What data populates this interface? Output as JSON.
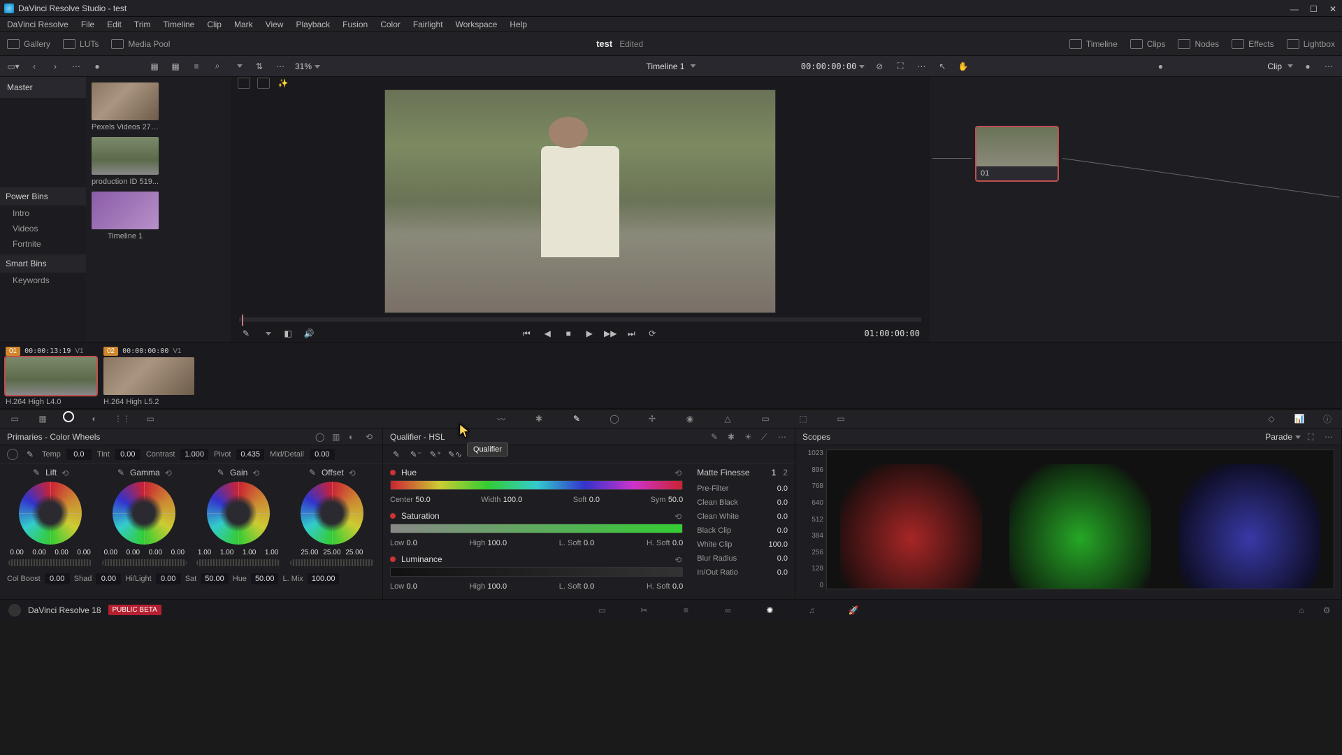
{
  "title": "DaVinci Resolve Studio - test",
  "menu": [
    "DaVinci Resolve",
    "File",
    "Edit",
    "Trim",
    "Timeline",
    "Clip",
    "Mark",
    "View",
    "Playback",
    "Fusion",
    "Color",
    "Fairlight",
    "Workspace",
    "Help"
  ],
  "tabs_left": [
    {
      "icon": "gallery",
      "label": "Gallery"
    },
    {
      "icon": "luts",
      "label": "LUTs"
    },
    {
      "icon": "media",
      "label": "Media Pool"
    }
  ],
  "tabs_right": [
    {
      "icon": "timeline",
      "label": "Timeline"
    },
    {
      "icon": "clips",
      "label": "Clips"
    },
    {
      "icon": "nodes",
      "label": "Nodes"
    },
    {
      "icon": "effects",
      "label": "Effects"
    },
    {
      "icon": "lightbox",
      "label": "Lightbox"
    }
  ],
  "project": {
    "name": "test",
    "status": "Edited"
  },
  "toolbar": {
    "zoom": "31%",
    "timeline_name": "Timeline 1",
    "timecode": "00:00:00:00",
    "clip_label": "Clip"
  },
  "mediapool": {
    "master": "Master",
    "sections": {
      "power": "Power Bins",
      "power_items": [
        "Intro",
        "Videos",
        "Fortnite"
      ],
      "smart": "Smart Bins",
      "smart_items": [
        "Keywords"
      ]
    },
    "thumbs": [
      {
        "label": "Pexels Videos 278...",
        "style": "th1"
      },
      {
        "label": "production ID 519...",
        "style": "th2"
      },
      {
        "label": "Timeline 1",
        "style": "th3"
      }
    ]
  },
  "transport": {
    "tc": "01:00:00:00"
  },
  "node": {
    "label": "01"
  },
  "clips": [
    {
      "num": "01",
      "tc": "00:00:13:19",
      "v": "V1",
      "label": "H.264 High L4.0",
      "style": "th2",
      "active": true
    },
    {
      "num": "02",
      "tc": "00:00:00:00",
      "v": "V1",
      "label": "H.264 High L5.2",
      "style": "th1",
      "active": false
    }
  ],
  "primaries": {
    "title": "Primaries - Color Wheels",
    "adj_top": [
      {
        "lbl": "Temp",
        "val": "0.0"
      },
      {
        "lbl": "Tint",
        "val": "0.00"
      },
      {
        "lbl": "Contrast",
        "val": "1.000"
      },
      {
        "lbl": "Pivot",
        "val": "0.435"
      },
      {
        "lbl": "Mid/Detail",
        "val": "0.00"
      }
    ],
    "wheels": [
      {
        "name": "Lift",
        "vals": [
          "0.00",
          "0.00",
          "0.00",
          "0.00"
        ]
      },
      {
        "name": "Gamma",
        "vals": [
          "0.00",
          "0.00",
          "0.00",
          "0.00"
        ]
      },
      {
        "name": "Gain",
        "vals": [
          "1.00",
          "1.00",
          "1.00",
          "1.00"
        ]
      },
      {
        "name": "Offset",
        "vals": [
          "25.00",
          "25.00",
          "25.00"
        ]
      }
    ],
    "adj_bottom": [
      {
        "lbl": "Col Boost",
        "val": "0.00"
      },
      {
        "lbl": "Shad",
        "val": "0.00"
      },
      {
        "lbl": "Hi/Light",
        "val": "0.00"
      },
      {
        "lbl": "Sat",
        "val": "50.00"
      },
      {
        "lbl": "Hue",
        "val": "50.00"
      },
      {
        "lbl": "L. Mix",
        "val": "100.00"
      }
    ]
  },
  "qualifier": {
    "title": "Qualifier - HSL",
    "tooltip": "Qualifier",
    "rows": [
      {
        "name": "Hue",
        "bar": "hue",
        "params": [
          [
            "Center",
            "50.0"
          ],
          [
            "Width",
            "100.0"
          ],
          [
            "Soft",
            "0.0"
          ],
          [
            "Sym",
            "50.0"
          ]
        ]
      },
      {
        "name": "Saturation",
        "bar": "sat",
        "params": [
          [
            "Low",
            "0.0"
          ],
          [
            "High",
            "100.0"
          ],
          [
            "L. Soft",
            "0.0"
          ],
          [
            "H. Soft",
            "0.0"
          ]
        ]
      },
      {
        "name": "Luminance",
        "bar": "lum",
        "params": [
          [
            "Low",
            "0.0"
          ],
          [
            "High",
            "100.0"
          ],
          [
            "L. Soft",
            "0.0"
          ],
          [
            "H. Soft",
            "0.0"
          ]
        ]
      }
    ],
    "matte": {
      "title": "Matte Finesse",
      "page1": "1",
      "page2": "2",
      "rows": [
        {
          "lbl": "Pre-Filter",
          "val": "0.0"
        },
        {
          "lbl": "Clean Black",
          "val": "0.0"
        },
        {
          "lbl": "Clean White",
          "val": "0.0"
        },
        {
          "lbl": "Black Clip",
          "val": "0.0"
        },
        {
          "lbl": "White Clip",
          "val": "100.0"
        },
        {
          "lbl": "Blur Radius",
          "val": "0.0"
        },
        {
          "lbl": "In/Out Ratio",
          "val": "0.0"
        }
      ]
    }
  },
  "scopes": {
    "title": "Scopes",
    "mode": "Parade",
    "scale": [
      "1023",
      "896",
      "768",
      "640",
      "512",
      "384",
      "256",
      "128",
      "0"
    ]
  },
  "footer": {
    "version": "DaVinci Resolve 18",
    "beta": "PUBLIC BETA"
  }
}
